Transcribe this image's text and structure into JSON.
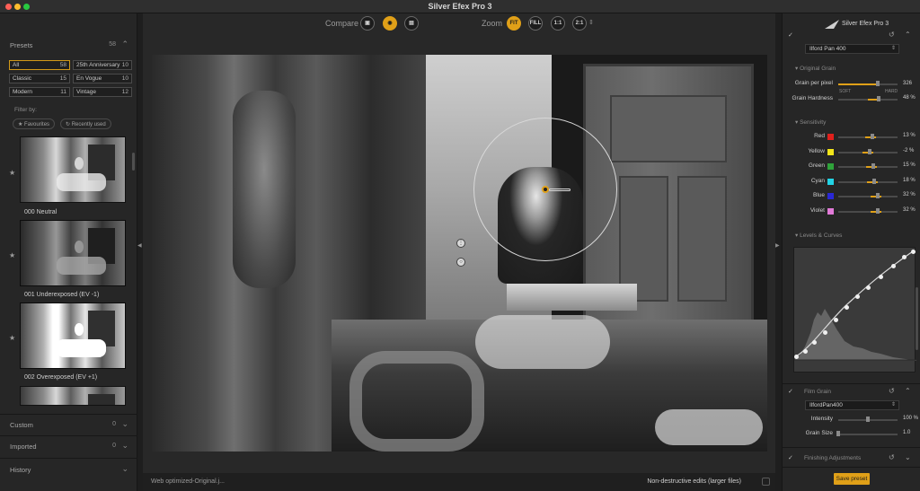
{
  "window": {
    "title": "Silver Efex Pro 3"
  },
  "left": {
    "presets": {
      "title": "Presets",
      "count": "58"
    },
    "chips": [
      {
        "label": "All",
        "count": "58"
      },
      {
        "label": "25th Anniversary",
        "count": "10"
      },
      {
        "label": "Classic",
        "count": "15"
      },
      {
        "label": "En Vogue",
        "count": "10"
      },
      {
        "label": "Modern",
        "count": "11"
      },
      {
        "label": "Vintage",
        "count": "12"
      }
    ],
    "filter_label": "Filter by:",
    "filter_favourites": "★ Favourites",
    "filter_recent": "↻ Recently used",
    "thumbs": [
      "000 Neutral",
      "001 Underexposed (EV -1)",
      "002 Overexposed (EV +1)"
    ],
    "custom": {
      "title": "Custom",
      "count": "0"
    },
    "imported": {
      "title": "Imported",
      "count": "0"
    },
    "history": {
      "title": "History"
    }
  },
  "toolbar": {
    "compare_label": "Compare",
    "zoom_label": "Zoom",
    "zoom_fit": "FIT",
    "zoom_fill": "FILL",
    "zoom_11": "1:1",
    "zoom_21": "2:1"
  },
  "status": {
    "filename": "Web optimized-Original.j...",
    "nondestructive": "Non-destructive edits (larger files)"
  },
  "right": {
    "brand": "Silver Efex Pro 3",
    "film_select": "Ilford Pan 400",
    "original_grain": "Original Grain",
    "grain_per_pixel": {
      "label": "Grain per pixel",
      "value": "326"
    },
    "grain_hardness": {
      "label": "Grain Hardness",
      "value": "48 %",
      "soft": "SOFT",
      "hard": "HARD"
    },
    "sensitivity": "Sensitivity",
    "channels": [
      {
        "label": "Red",
        "value": "13 %",
        "color": "#e0201c"
      },
      {
        "label": "Yellow",
        "value": "-2 %",
        "color": "#f2e51a"
      },
      {
        "label": "Green",
        "value": "15 %",
        "color": "#2fa33a"
      },
      {
        "label": "Cyan",
        "value": "18 %",
        "color": "#22d4e6"
      },
      {
        "label": "Blue",
        "value": "32 %",
        "color": "#2a28d6"
      },
      {
        "label": "Violet",
        "value": "32 %",
        "color": "#e27ad8"
      }
    ],
    "levels_curves": "Levels & Curves",
    "film_grain": "Film Grain",
    "grain_select": "IlfordPan400",
    "intensity": {
      "label": "Intensity",
      "value": "100 %"
    },
    "grain_size": {
      "label": "Grain Size",
      "value": "1.0"
    },
    "finishing": "Finishing Adjustments",
    "save_preset": "Save preset"
  },
  "colors": {
    "accent": "#e0a018"
  }
}
